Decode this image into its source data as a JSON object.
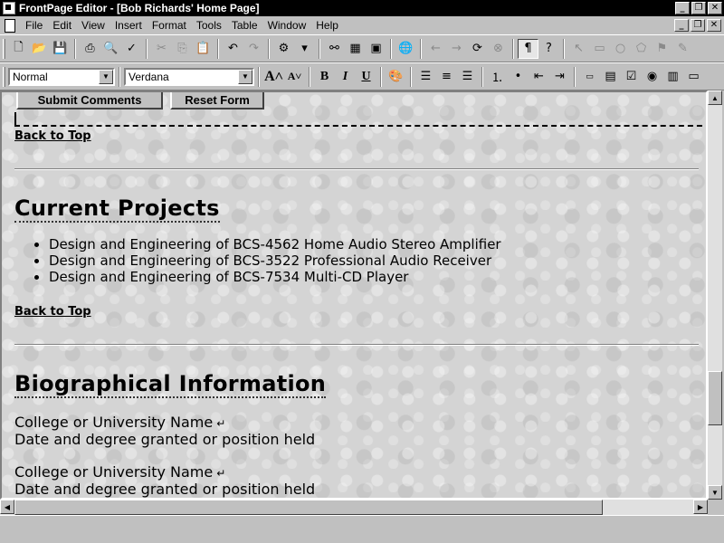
{
  "window": {
    "title": "FrontPage Editor - [Bob Richards' Home Page]"
  },
  "menu": {
    "items": [
      "File",
      "Edit",
      "View",
      "Insert",
      "Format",
      "Tools",
      "Table",
      "Window",
      "Help"
    ]
  },
  "format_toolbar": {
    "style_value": "Normal",
    "font_value": "Verdana"
  },
  "toolbar_icons": {
    "standard": [
      "new-page-icon",
      "open-icon",
      "save-icon",
      "print-icon",
      "print-preview-icon",
      "spelling-icon",
      "cut-icon",
      "copy-icon",
      "paste-icon",
      "undo-icon",
      "redo-icon",
      "webbot-icon",
      "form-field-icon",
      "table-icon",
      "image-icon",
      "hyperlink-icon",
      "back-icon",
      "forward-icon",
      "refresh-icon",
      "stop-icon",
      "show-paragraph-icon",
      "help-icon",
      "select-icon",
      "rectangle-icon",
      "circle-icon",
      "polygon-icon",
      "hotspot-icon",
      "highlight-icon"
    ],
    "format": [
      "increase-font-icon",
      "decrease-font-icon",
      "bold-icon",
      "italic-icon",
      "underline-icon",
      "text-color-icon",
      "align-left-icon",
      "align-center-icon",
      "align-right-icon",
      "numbered-list-icon",
      "bulleted-list-icon",
      "decrease-indent-icon",
      "increase-indent-icon",
      "textbox-icon",
      "scrolling-textbox-icon",
      "checkbox-icon",
      "radio-button-icon",
      "dropdown-menu-icon",
      "push-button-icon"
    ]
  },
  "page": {
    "form_buttons": {
      "submit": "Submit Comments",
      "reset": "Reset Form"
    },
    "back_to_top_1": "Back to Top",
    "back_to_top_2": "Back to Top",
    "projects_heading": "Current Projects",
    "projects": [
      "Design and Engineering of BCS-4562 Home Audio Stereo Amplifier",
      "Design and Engineering of BCS-3522 Professional Audio Receiver",
      "Design and Engineering of BCS-7534 Multi-CD Player"
    ],
    "bio_heading": "Biographical Information",
    "bio_entries": [
      {
        "name": "College or University Name",
        "detail": "Date and degree granted or position held"
      },
      {
        "name": "College or University Name",
        "detail": "Date and degree granted or position held"
      }
    ],
    "line_break_glyph": "↵"
  }
}
